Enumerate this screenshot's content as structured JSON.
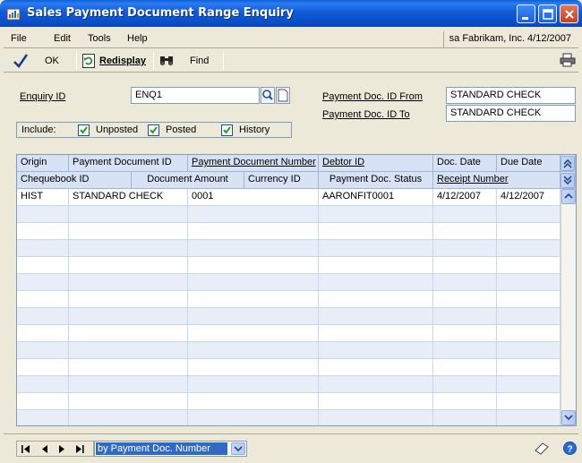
{
  "window": {
    "title": "Sales Payment Document Range Enquiry"
  },
  "menu": {
    "items": [
      "File",
      "Edit",
      "Tools",
      "Help"
    ],
    "user_info": "sa  Fabrikam, Inc.  4/12/2007"
  },
  "toolbar": {
    "ok_label": "OK",
    "redisplay_label": "Redisplay",
    "find_label": "Find"
  },
  "form": {
    "enquiry_id_label": "Enquiry ID",
    "enquiry_id_value": "ENQ1",
    "doc_from_label": "Payment Doc. ID From",
    "doc_from_value": "STANDARD CHECK",
    "doc_to_label": "Payment Doc. ID To",
    "doc_to_value": "STANDARD CHECK",
    "include_label": "Include:",
    "include_options": [
      {
        "label": "Unposted",
        "checked": true
      },
      {
        "label": "Posted",
        "checked": true
      },
      {
        "label": "History",
        "checked": true
      }
    ]
  },
  "grid": {
    "header_row1": [
      "Origin",
      "Payment Document ID",
      "Payment Document Number",
      "Debtor ID",
      "Doc. Date",
      "Due Date"
    ],
    "header_row2": [
      "Chequebook ID",
      "Document Amount",
      "Currency ID",
      "Payment Doc. Status",
      "Receipt Number"
    ],
    "rows": [
      [
        "HIST",
        "STANDARD CHECK",
        "0001",
        "AARONFIT0001",
        "4/12/2007",
        "4/12/2007"
      ]
    ]
  },
  "footer": {
    "sort_value": "by Payment Doc. Number"
  },
  "colors": {
    "titlebar": "#0B50C8",
    "header_bg": "#D7E3F4",
    "selection": "#316AC5",
    "window_bg": "#ECE9D8"
  }
}
